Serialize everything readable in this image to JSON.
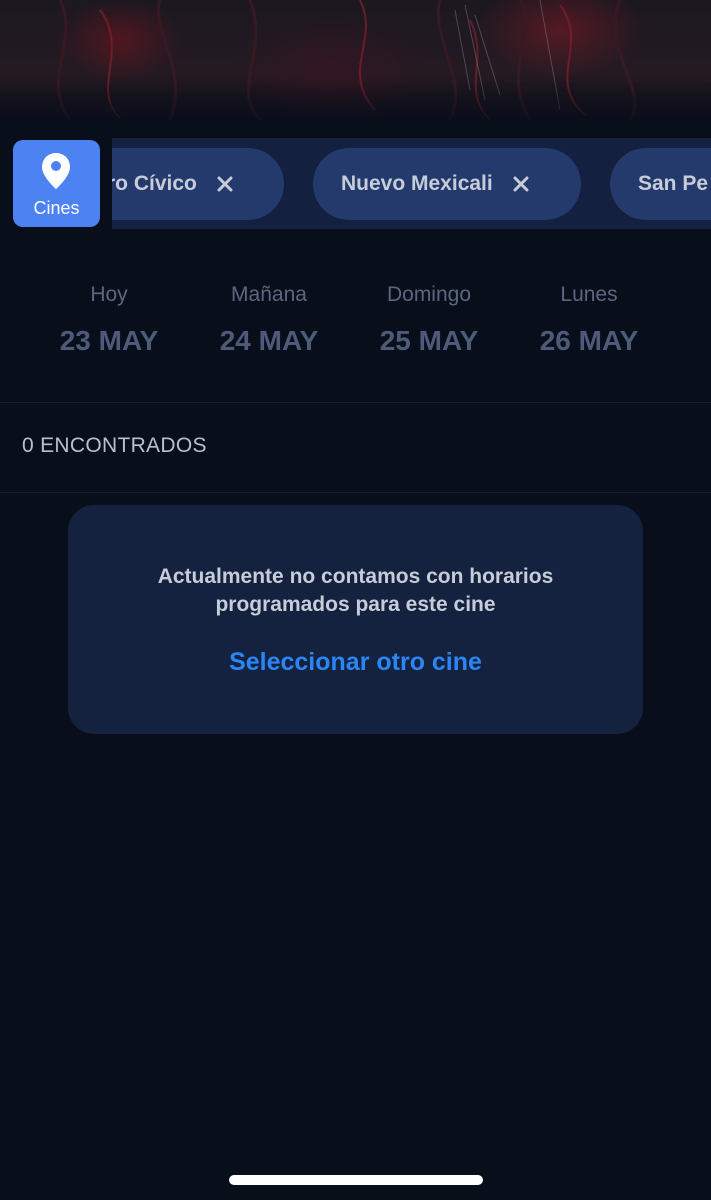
{
  "filters": {
    "cines_label": "Cines",
    "chips": [
      {
        "label": "Centro Cívico",
        "shown_label": "tro Cívico"
      },
      {
        "label": "Nuevo Mexicali"
      },
      {
        "label": "San Pe"
      }
    ]
  },
  "dates": [
    {
      "day": "Hoy",
      "date": "23 MAY"
    },
    {
      "day": "Mañana",
      "date": "24 MAY"
    },
    {
      "day": "Domingo",
      "date": "25 MAY"
    },
    {
      "day": "Lunes",
      "date": "26 MAY"
    }
  ],
  "results": {
    "count_label": "0 ENCONTRADOS"
  },
  "empty_state": {
    "line1": "Actualmente no contamos con horarios",
    "line2": "programados para este cine",
    "link": "Seleccionar otro cine"
  },
  "colors": {
    "background": "#090e1b",
    "accent": "#4d82f2",
    "link": "#2a86f5",
    "chip": "#243a6d",
    "card": "#14213f"
  }
}
